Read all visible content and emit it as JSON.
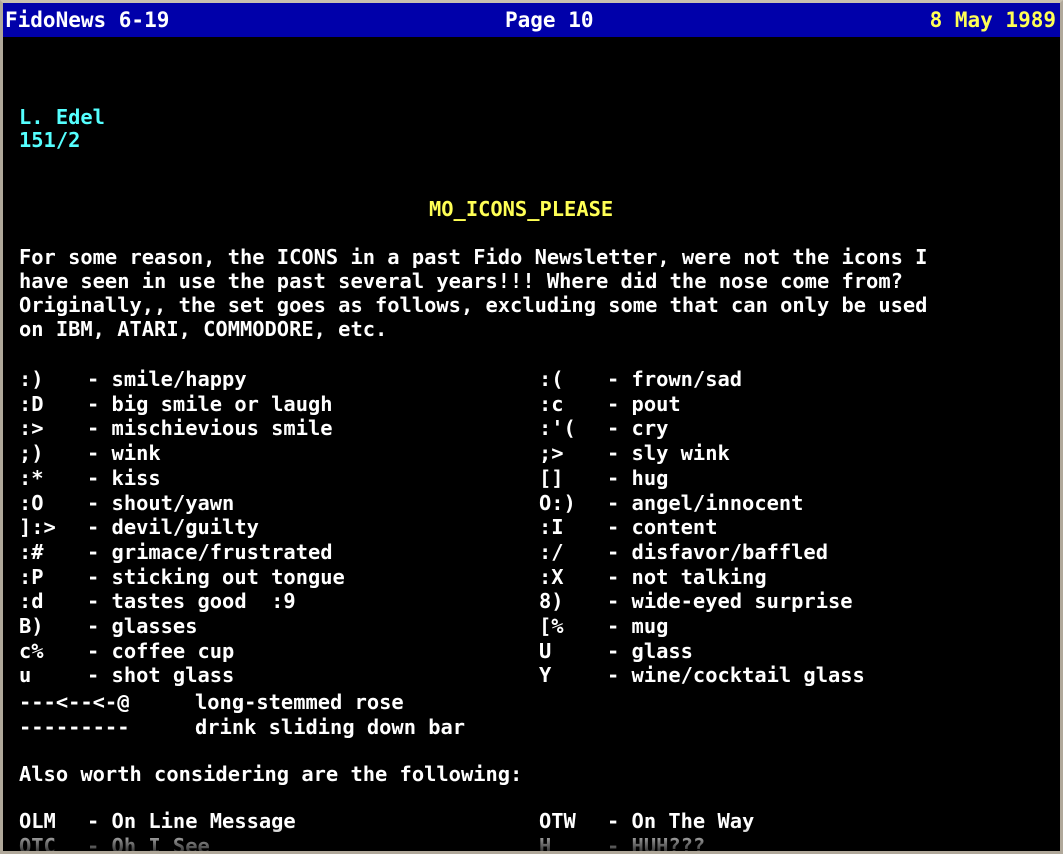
{
  "header": {
    "left": "FidoNews 6-19",
    "center": "Page 10",
    "right": "8 May 1989"
  },
  "author": {
    "name": "L. Edel",
    "node": "151/2"
  },
  "article": {
    "title": "MO_ICONS_PLEASE",
    "paragraph": [
      "For some reason, the ICONS in a past Fido Newsletter, were not the icons I",
      "have seen in use the past several years!!! Where did the nose come from?",
      "Originally,, the set goes as follows, excluding some that can only be used",
      "on IBM, ATARI, COMMODORE, etc."
    ]
  },
  "icons_left": [
    {
      "sym": ":)",
      "desc": "- smile/happy"
    },
    {
      "sym": ":D",
      "desc": "- big smile or laugh"
    },
    {
      "sym": ":>",
      "desc": "- mischievious smile"
    },
    {
      "sym": ";)",
      "desc": "- wink"
    },
    {
      "sym": ":*",
      "desc": "- kiss"
    },
    {
      "sym": ":O",
      "desc": "- shout/yawn"
    },
    {
      "sym": "]:>",
      "desc": "- devil/guilty"
    },
    {
      "sym": ":#",
      "desc": "- grimace/frustrated"
    },
    {
      "sym": ":P",
      "desc": "- sticking out tongue"
    },
    {
      "sym": ":d",
      "desc": "- tastes good  :9"
    },
    {
      "sym": "B)",
      "desc": "- glasses"
    },
    {
      "sym": "c%",
      "desc": "- coffee cup"
    },
    {
      "sym": "u",
      "desc": "- shot glass"
    }
  ],
  "icons_right": [
    {
      "sym": ":(",
      "desc": "- frown/sad"
    },
    {
      "sym": ":c",
      "desc": "- pout"
    },
    {
      "sym": ":'(",
      "desc": "- cry"
    },
    {
      "sym": ";>",
      "desc": "- sly wink"
    },
    {
      "sym": "[]",
      "desc": "- hug"
    },
    {
      "sym": "O:)",
      "desc": "- angel/innocent"
    },
    {
      "sym": ":I",
      "desc": "- content"
    },
    {
      "sym": ":/",
      "desc": "- disfavor/baffled"
    },
    {
      "sym": ":X",
      "desc": "- not talking"
    },
    {
      "sym": "8)",
      "desc": "- wide-eyed surprise"
    },
    {
      "sym": "[%",
      "desc": "- mug"
    },
    {
      "sym": "U",
      "desc": "- glass"
    },
    {
      "sym": "Y",
      "desc": "- wine/cocktail glass"
    }
  ],
  "extras": [
    {
      "sym": "---<--<-@",
      "desc": "long-stemmed rose"
    },
    {
      "sym": "---------",
      "desc": "drink sliding down bar"
    }
  ],
  "also_heading": "Also worth considering are the following:",
  "abbrev_left": [
    {
      "sym": "OLM",
      "desc": "- On Line Message"
    },
    {
      "sym": "OTC",
      "desc": "- Oh I See"
    }
  ],
  "abbrev_right": [
    {
      "sym": "OTW",
      "desc": "- On The Way"
    },
    {
      "sym": "H",
      "desc": "- HUH???"
    }
  ]
}
